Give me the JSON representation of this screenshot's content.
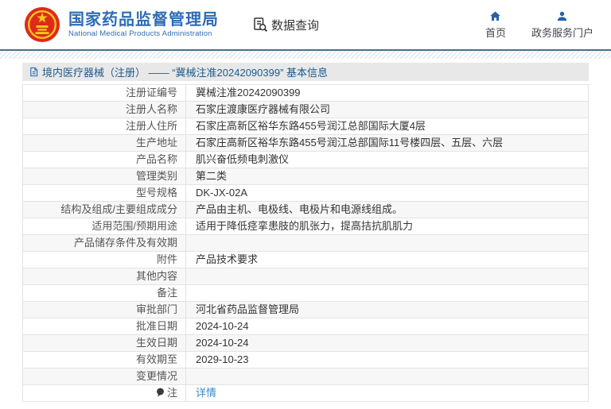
{
  "header": {
    "logo": {
      "org_name_cn": "国家药品监督管理局",
      "org_name_en": "National Medical Products Administration"
    },
    "data_query": {
      "label": "数据查询"
    },
    "nav": {
      "home": {
        "label": "首页"
      },
      "portal": {
        "label": "政务服务门户"
      }
    }
  },
  "page": {
    "title": "境内医疗器械（注册） —— “冀械注准20242090399” 基本信息"
  },
  "info_table": {
    "rows": [
      {
        "label": "注册证编号",
        "value": "冀械注准20242090399"
      },
      {
        "label": "注册人名称",
        "value": "石家庄渡康医疗器械有限公司"
      },
      {
        "label": "注册人住所",
        "value": "石家庄高新区裕华东路455号润江总部国际大厦4层"
      },
      {
        "label": "生产地址",
        "value": "石家庄高新区裕华东路455号润江总部国际11号楼四层、五层、六层"
      },
      {
        "label": "产品名称",
        "value": "肌兴奋低频电刺激仪"
      },
      {
        "label": "管理类别",
        "value": "第二类"
      },
      {
        "label": "型号规格",
        "value": "DK-JX-02A"
      },
      {
        "label": "结构及组成/主要组成成分",
        "value": "产品由主机、电极线、电极片和电源线组成。"
      },
      {
        "label": "适用范围/预期用途",
        "value": "适用于降低痉挛患肢的肌张力，提高拮抗肌肌力"
      },
      {
        "label": "产品储存条件及有效期",
        "value": ""
      },
      {
        "label": "附件",
        "value": "产品技术要求"
      },
      {
        "label": "其他内容",
        "value": ""
      },
      {
        "label": "备注",
        "value": ""
      },
      {
        "label": "审批部门",
        "value": "河北省药品监督管理局"
      },
      {
        "label": "批准日期",
        "value": "2024-10-24"
      },
      {
        "label": "生效日期",
        "value": "2024-10-24"
      },
      {
        "label": "有效期至",
        "value": "2029-10-23"
      },
      {
        "label": "变更情况",
        "value": ""
      },
      {
        "label": "注",
        "label_icon": "note-icon",
        "value": "详情",
        "value_is_link": true
      }
    ]
  },
  "colors": {
    "brand_blue": "#2e6cb4",
    "icon_blue": "#2563a8",
    "title_text": "#1c5a8c",
    "title_bar_bg": "#e8e8e8",
    "alt_row_bg": "#f7f7f7",
    "row_border": "#e3e3e3",
    "link": "#3a87c8",
    "emblem_red": "#de2a1a",
    "emblem_gold": "#f5c51e"
  }
}
